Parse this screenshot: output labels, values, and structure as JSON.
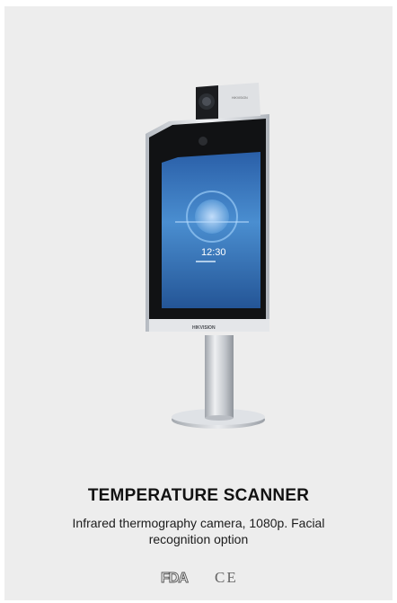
{
  "product": {
    "title": "TEMPERATURE SCANNER",
    "description": "Infrared thermography camera, 1080p. Facial recognition option",
    "screen_time": "12:30",
    "brand_mark": "HIKVISION"
  },
  "certifications": [
    {
      "label": "FDA",
      "icon": "fda-logo"
    },
    {
      "label": "CE",
      "icon": "ce-mark"
    }
  ],
  "colors": {
    "card_background": "#ededed",
    "screen_blue": "#3f7fc4",
    "stand_silver": "#c9ccd1",
    "text": "#121212"
  }
}
